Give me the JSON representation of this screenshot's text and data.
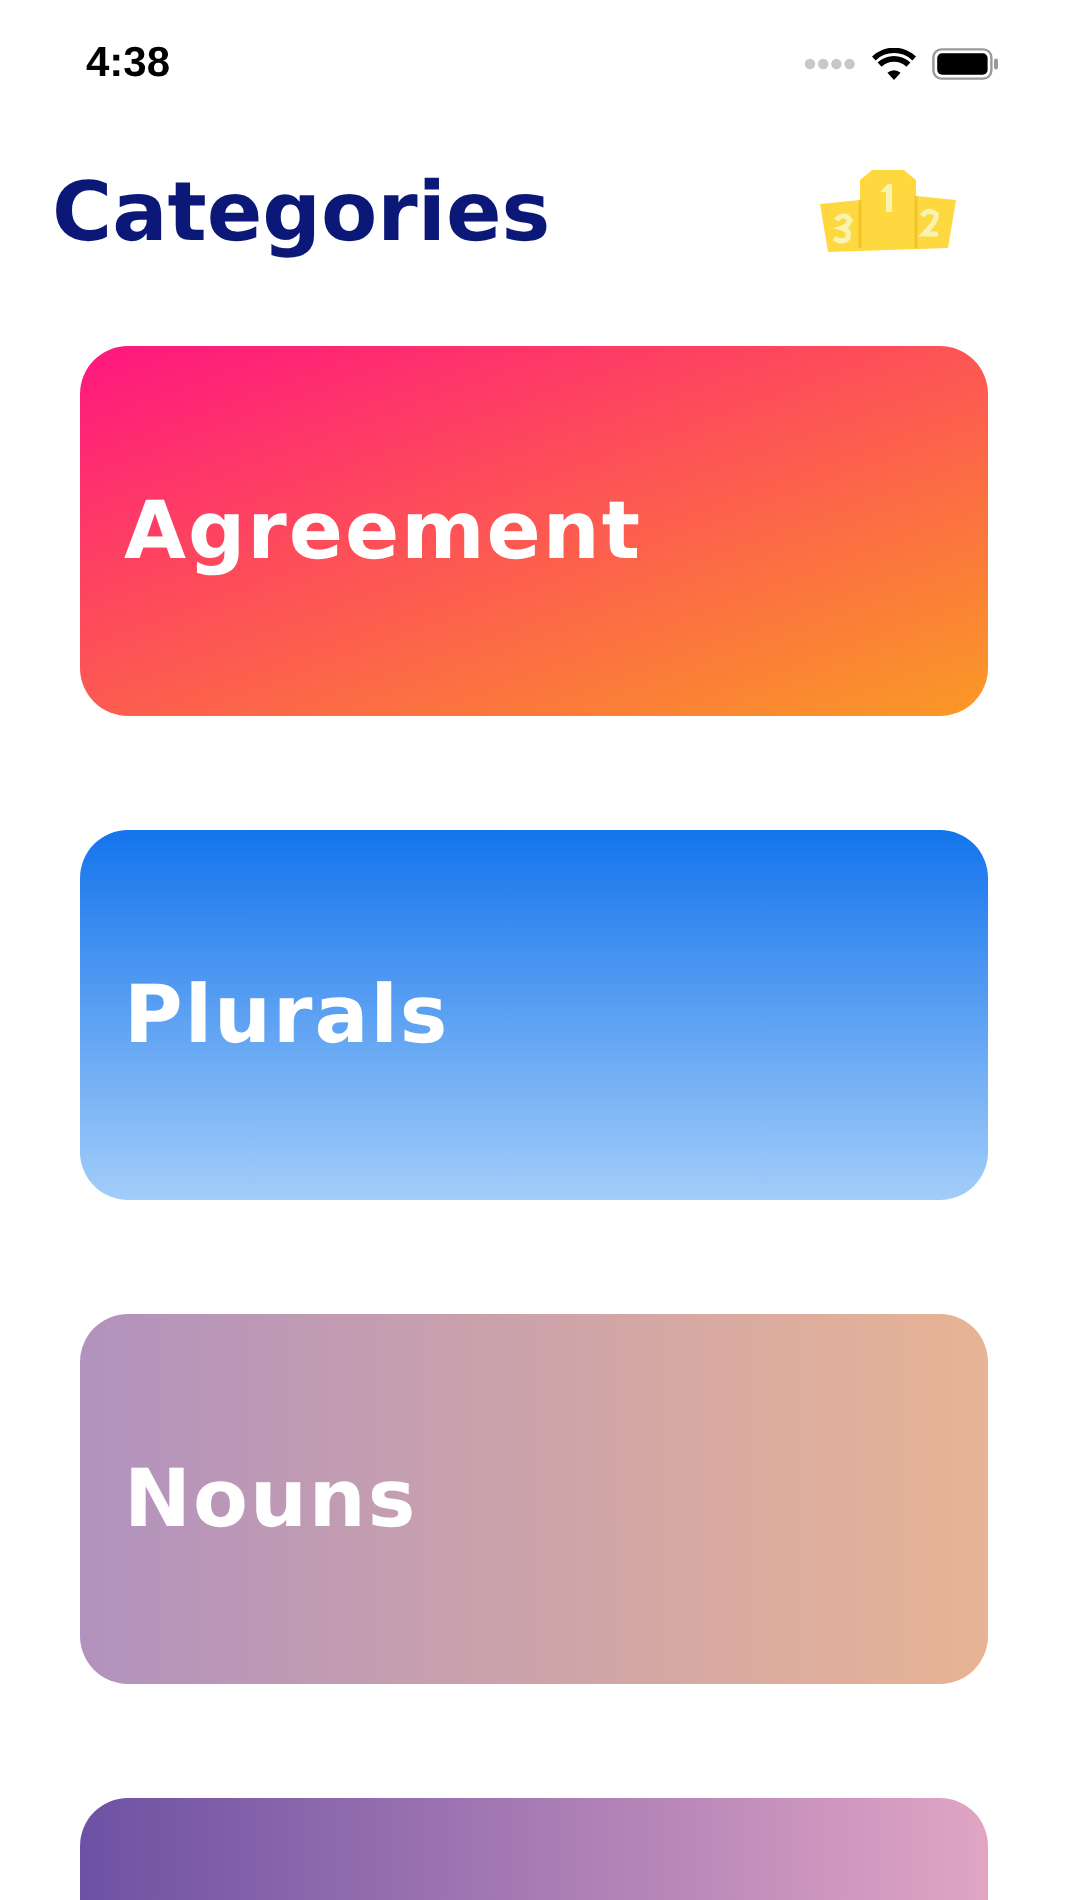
{
  "status_bar": {
    "time": "4:38"
  },
  "header": {
    "title": "Categories"
  },
  "categories": [
    {
      "label": "Agreement",
      "kind": "sunset",
      "color": "#ff167f"
    },
    {
      "label": "Plurals",
      "kind": "sky",
      "color": "#1474ec"
    },
    {
      "label": "Nouns",
      "kind": "peach",
      "color": "#b292be"
    },
    {
      "kind": "lilac",
      "color": "#6d51a4"
    }
  ]
}
